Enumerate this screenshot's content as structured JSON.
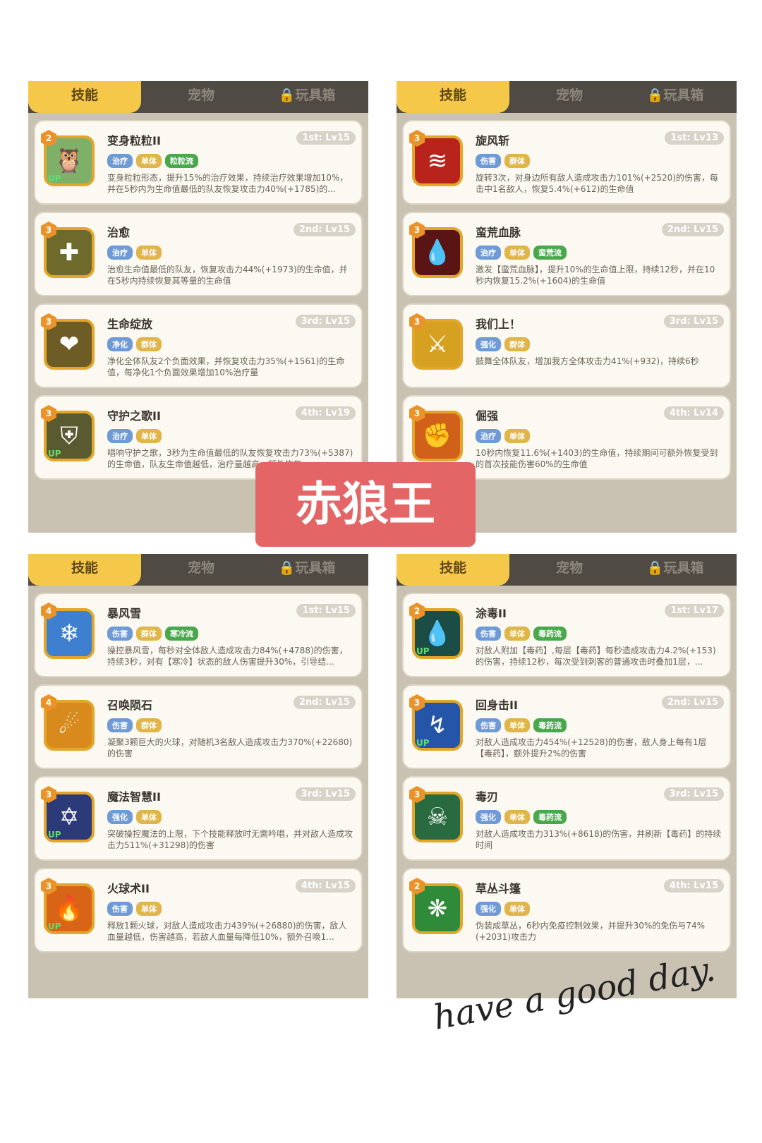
{
  "tabs": {
    "skills": "技能",
    "pets": "宠物",
    "toys": "玩具箱"
  },
  "banner": "赤狼王",
  "signature": "have a good day.",
  "colors": {
    "tab_active": "#f6c84a",
    "tag_blue": "#6e9ad6",
    "tag_gold": "#e0b549",
    "tag_green": "#49a84c",
    "banner": "#e46566"
  },
  "panels": [
    {
      "cards": [
        {
          "rank": "2",
          "name": "变身粒粒II",
          "level": "1st: Lv15",
          "icon": "owl-icon",
          "up": true,
          "tags": [
            [
              "治疗",
              "blue"
            ],
            [
              "单体",
              "gold"
            ],
            [
              "粒粒流",
              "green"
            ]
          ],
          "desc": "变身粒粒形态，提升15%的治疗效果，持续治疗效果增加10%，并在5秒内为生命值最低的队友恢复攻击力40%(+1785)的..."
        },
        {
          "rank": "3",
          "name": "治愈",
          "level": "2nd: Lv15",
          "icon": "heal-cross-icon",
          "up": false,
          "tags": [
            [
              "治疗",
              "blue"
            ],
            [
              "单体",
              "gold"
            ]
          ],
          "desc": "治愈生命值最低的队友，恢复攻击力44%(+1973)的生命值，并在5秒内持续恢复其等量的生命值"
        },
        {
          "rank": "3",
          "name": "生命绽放",
          "level": "3rd: Lv15",
          "icon": "bloom-heart-icon",
          "up": false,
          "tags": [
            [
              "净化",
              "blue"
            ],
            [
              "群体",
              "gold"
            ]
          ],
          "desc": "净化全体队友2个负面效果，并恢复攻击力35%(+1561)的生命值，每净化1个负面效果增加10%治疗量"
        },
        {
          "rank": "3",
          "name": "守护之歌II",
          "level": "4th: Lv19",
          "icon": "guardian-shield-icon",
          "up": true,
          "tags": [
            [
              "治疗",
              "blue"
            ],
            [
              "单体",
              "gold"
            ]
          ],
          "desc": "唱响守护之歌，3秒为生命值最低的队友恢复攻击力73%(+5387)的生命值，队友生命值越低，治疗量越高，额外恢复..."
        }
      ]
    },
    {
      "cards": [
        {
          "rank": "3",
          "name": "旋风斩",
          "level": "1st: Lv13",
          "icon": "whirlwind-slash-icon",
          "up": false,
          "tags": [
            [
              "伤害",
              "blue"
            ],
            [
              "群体",
              "gold"
            ]
          ],
          "desc": "旋转3次，对身边所有敌人造成攻击力101%(+2520)的伤害，每击中1名敌人，恢复5.4%(+612)的生命值"
        },
        {
          "rank": "3",
          "name": "蛮荒血脉",
          "level": "2nd: Lv15",
          "icon": "blood-drop-icon",
          "up": false,
          "tags": [
            [
              "治疗",
              "blue"
            ],
            [
              "单体",
              "gold"
            ],
            [
              "蛮荒流",
              "green"
            ]
          ],
          "desc": "激发【蛮荒血脉】，提升10%的生命值上限，持续12秒，并在10秒内恢复15.2%(+1604)的生命值"
        },
        {
          "rank": "3",
          "name": "我们上！",
          "level": "3rd: Lv15",
          "icon": "rally-icon",
          "up": false,
          "tags": [
            [
              "强化",
              "blue"
            ],
            [
              "群体",
              "gold"
            ]
          ],
          "desc": "鼓舞全体队友，增加我方全体攻击力41%(+932)，持续6秒"
        },
        {
          "rank": "3",
          "name": "倔强",
          "level": "4th: Lv14",
          "icon": "stubborn-icon",
          "up": false,
          "tags": [
            [
              "治疗",
              "blue"
            ],
            [
              "单体",
              "gold"
            ]
          ],
          "desc": "10秒内恢复11.6%(+1403)的生命值，持续期间可额外恢复受到的首次技能伤害60%的生命值"
        }
      ]
    },
    {
      "cards": [
        {
          "rank": "4",
          "name": "暴风雪",
          "level": "1st: Lv15",
          "icon": "blizzard-icon",
          "up": false,
          "tags": [
            [
              "伤害",
              "blue"
            ],
            [
              "群体",
              "gold"
            ],
            [
              "寒冷流",
              "green"
            ]
          ],
          "desc": "操控暴风雪，每秒对全体敌人造成攻击力84%(+4788)的伤害，持续3秒，对有【寒冷】状态的敌人伤害提升30%，引导结..."
        },
        {
          "rank": "4",
          "name": "召唤陨石",
          "level": "2nd: Lv15",
          "icon": "meteor-icon",
          "up": false,
          "tags": [
            [
              "伤害",
              "blue"
            ],
            [
              "群体",
              "gold"
            ]
          ],
          "desc": "凝聚3颗巨大的火球，对随机3名敌人造成攻击力370%(+22680)的伤害"
        },
        {
          "rank": "3",
          "name": "魔法智慧II",
          "level": "3rd: Lv15",
          "icon": "magic-wisdom-icon",
          "up": true,
          "tags": [
            [
              "强化",
              "blue"
            ],
            [
              "单体",
              "gold"
            ]
          ],
          "desc": "突破操控魔法的上限，下个技能释放时无需吟唱，并对敌人造成攻击力511%(+31298)的伤害"
        },
        {
          "rank": "3",
          "name": "火球术II",
          "level": "4th: Lv15",
          "icon": "fireball-icon",
          "up": true,
          "tags": [
            [
              "伤害",
              "blue"
            ],
            [
              "单体",
              "gold"
            ]
          ],
          "desc": "释放1颗火球，对敌人造成攻击力439%(+26880)的伤害，敌人血量越低，伤害越高，若敌人血量每降低10%，额外召唤1..."
        }
      ]
    },
    {
      "cards": [
        {
          "rank": "2",
          "name": "涂毒II",
          "level": "1st: Lv17",
          "icon": "poison-drop-icon",
          "up": true,
          "tags": [
            [
              "伤害",
              "blue"
            ],
            [
              "单体",
              "gold"
            ],
            [
              "毒药流",
              "green"
            ]
          ],
          "desc": "对敌人附加【毒药】,每层【毒药】每秒造成攻击力4.2%(+153)的伤害，持续12秒，每次受到刺客的普通攻击时叠加1层，..."
        },
        {
          "rank": "3",
          "name": "回身击II",
          "level": "2nd: Lv15",
          "icon": "back-strike-icon",
          "up": true,
          "tags": [
            [
              "伤害",
              "blue"
            ],
            [
              "单体",
              "gold"
            ],
            [
              "毒药流",
              "green"
            ]
          ],
          "desc": "对敌人造成攻击力454%(+12528)的伤害，敌人身上每有1层【毒药】，额外提升2%的伤害"
        },
        {
          "rank": "3",
          "name": "毒刃",
          "level": "3rd: Lv15",
          "icon": "poison-skull-icon",
          "up": false,
          "tags": [
            [
              "强化",
              "blue"
            ],
            [
              "单体",
              "gold"
            ],
            [
              "毒药流",
              "green"
            ]
          ],
          "desc": "对敌人造成攻击力313%(+8618)的伤害，并刷新【毒药】的持续时间"
        },
        {
          "rank": "2",
          "name": "草丛斗篷",
          "level": "4th: Lv15",
          "icon": "bush-cloak-icon",
          "up": false,
          "tags": [
            [
              "强化",
              "blue"
            ],
            [
              "单体",
              "gold"
            ]
          ],
          "desc": "伪装成草丛，6秒内免疫控制效果，并提升30%的免伤与74%(+2031)攻击力"
        }
      ]
    }
  ]
}
